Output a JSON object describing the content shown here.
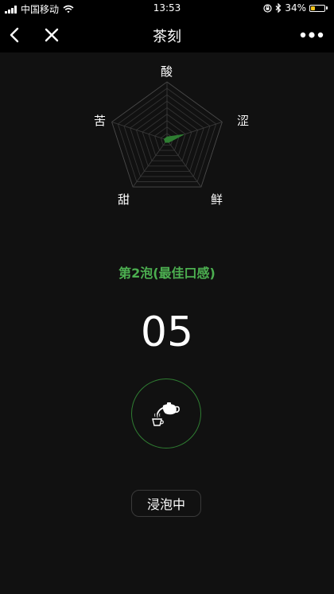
{
  "status_bar": {
    "carrier": "中国移动",
    "time": "13:53",
    "battery_percent": "34%",
    "battery_level": 0.34,
    "battery_color": "#f5c518",
    "icons": [
      "signal-icon",
      "wifi-icon",
      "orientation-lock-icon",
      "bluetooth-icon",
      "battery-icon"
    ]
  },
  "nav": {
    "title": "茶刻",
    "icons": [
      "back-icon",
      "close-icon",
      "more-icon"
    ]
  },
  "radar": {
    "axes": [
      "酸",
      "涩",
      "鲜",
      "甜",
      "苦"
    ],
    "values": [
      0.05,
      0.3,
      0.05,
      0.05,
      0.05
    ],
    "fill_color": "#2e7d32"
  },
  "brew": {
    "stage_label": "第2泡(最佳口感)",
    "timer": "05",
    "status": "浸泡中",
    "accent_color": "#4caf50",
    "icon": "teapot-pour-icon"
  }
}
